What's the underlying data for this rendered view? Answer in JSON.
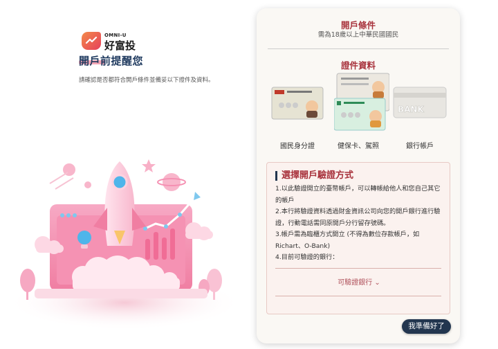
{
  "brand": {
    "small": "OMNI-U",
    "name": "好富投"
  },
  "header": {
    "title": "開戶前提醒您",
    "subtitle": "請確認是否都符合開戶條件並備妥以下證件及資料。"
  },
  "conditions": {
    "title": "開戶條件",
    "text": "需為18歲以上中華民國國民"
  },
  "documents": {
    "title": "證件資料",
    "items": [
      {
        "label": "國民身分證",
        "icon": "id-card-icon"
      },
      {
        "label": "健保卡、駕照",
        "icon": "health-card-icon"
      },
      {
        "label": "銀行帳戶",
        "icon": "bank-card-icon"
      }
    ],
    "card_text": {
      "bank": "BANK"
    }
  },
  "verification": {
    "title": "選擇開戶驗證方式",
    "items": [
      "1.以此驗證開立的臺幣帳戶，可以轉帳給他人和您自己其它的帳戶",
      "2.本行將驗證資料透過財金資訊公司向您的開戶銀行進行驗證，行動電話需同原開戶分行留存號碼。",
      "3.帳戶需為臨櫃方式開立 (不得為數位存款帳戶，如Richart、O-Bank)",
      "4.目前可驗證的銀行："
    ],
    "dropdown_label": "可驗證銀行"
  },
  "actions": {
    "ready": "我準備好了"
  },
  "colors": {
    "accent": "#a8323c",
    "navy": "#22364f",
    "pink": "#f28fb0"
  }
}
